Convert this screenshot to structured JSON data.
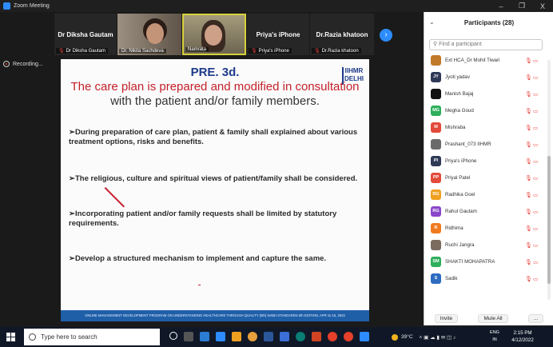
{
  "window": {
    "title": "Zoom Meeting",
    "minimize": "–",
    "restore": "❐",
    "close": "X"
  },
  "strip": {
    "tiles": [
      {
        "name": "Dr Diksha Gautam",
        "label": "Dr Diksha Gautam"
      },
      {
        "name": "",
        "label": "Dr. Nikita Sachdeva"
      },
      {
        "name": "",
        "label": "Namrata"
      },
      {
        "name": "Priya's iPhone",
        "label": "Priya's iPhone"
      },
      {
        "name": "Dr.Razia khatoon",
        "label": "Dr.Razia khatoon"
      }
    ],
    "next_icon": "›"
  },
  "recording": {
    "label": "Recording..."
  },
  "slide": {
    "heading": "PRE. 3d.",
    "logo_text": "IIHMR DELHI",
    "subtitle_red": "The care plan is prepared and modified in consultation",
    "subtitle_dark": "with the patient and/or family members.",
    "bullets": [
      "During preparation of care plan, patient & family shall explained about various treatment options, risks and benefits.",
      "The religious, culture and spiritual views of patient/family shall be considered.",
      "Incorporating patient and/or family requests shall be limited by statutory requirements.",
      "Develop a structured mechanism  to implement and capture the same."
    ],
    "footer": "ONLINE MANAGEMENT DEVELOPMENT PROGRAM ON UNDERSTANDING HEALTHCARE THROUGH QUALITY (5th) NABH STANDARDS 5th EDITION, APR 11-15, 2022"
  },
  "participants": {
    "title": "Participants (28)",
    "search_placeholder": "Find a participant",
    "items": [
      {
        "initials": "",
        "name": "Ext HCA_Dr Mohit Tiwari",
        "color": "#c07a2a"
      },
      {
        "initials": "JY",
        "name": "Jyoti yadav",
        "color": "#2f3a57"
      },
      {
        "initials": "",
        "name": "Manish Bajaj",
        "color": "#111111"
      },
      {
        "initials": "MG",
        "name": "Megha Goud",
        "color": "#2fae5b"
      },
      {
        "initials": "M",
        "name": "Mishraba",
        "color": "#e24b3b"
      },
      {
        "initials": "",
        "name": "Prashant_073 IIHMR",
        "color": "#6b6b6b"
      },
      {
        "initials": "PI",
        "name": "Priya's iPhone",
        "color": "#2f3a57"
      },
      {
        "initials": "PP",
        "name": "Priyal Patel",
        "color": "#e24b3b"
      },
      {
        "initials": "RG",
        "name": "Radhika Goel",
        "color": "#f0a020"
      },
      {
        "initials": "RG",
        "name": "Rahul Gautam",
        "color": "#8a47c9"
      },
      {
        "initials": "R",
        "name": "Ridhima",
        "color": "#f07a20"
      },
      {
        "initials": "",
        "name": "Ruchi Jangra",
        "color": "#7b6a5e"
      },
      {
        "initials": "SM",
        "name": "SHAKTI MOHAPATRA",
        "color": "#2fae5b"
      },
      {
        "initials": "S",
        "name": "Sadik",
        "color": "#2d6cc0"
      }
    ],
    "invite": "Invite",
    "mute_all": "Mute All",
    "more": "..."
  },
  "taskbar": {
    "search_placeholder": "Type here to search",
    "weather": "39°C",
    "lang_top": "ENG",
    "lang_bottom": "IN",
    "time": "2:15 PM",
    "date": "4/12/2022"
  }
}
